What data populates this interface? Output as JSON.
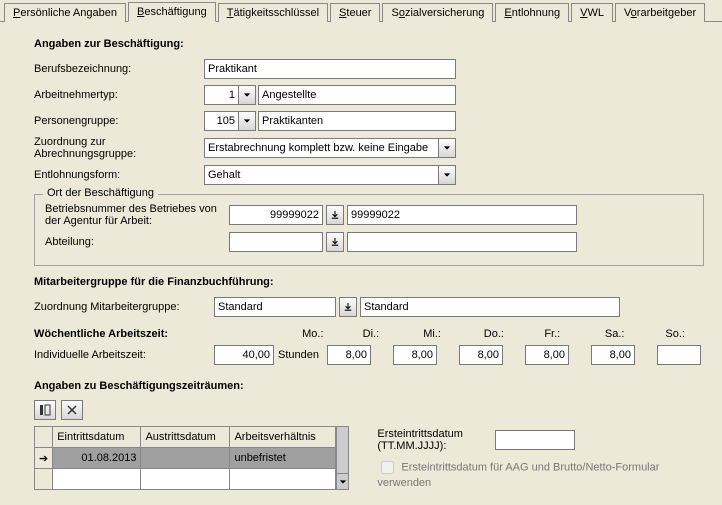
{
  "tabs": {
    "t0": "Persönliche Angaben",
    "t1": "Beschäftigung",
    "t2": "Tätigkeitsschlüssel",
    "t3": "Steuer",
    "t4": "Sozialversicherung",
    "t5": "Entlohnung",
    "t6": "VWL",
    "t7": "Vorarbeitgeber"
  },
  "section_employment": "Angaben zur Beschäftigung:",
  "labels": {
    "jobtitle": "Berufsbezeichnung:",
    "emptype": "Arbeitnehmertyp:",
    "pgroup": "Personengruppe:",
    "assign": "Zuordnung zur Abrechnungsgruppe:",
    "payform": "Entlohnungsform:",
    "workplace_legend": "Ort der Beschäftigung",
    "establishment": "Betriebsnummer des Betriebes von der Agentur für Arbeit:",
    "department": "Abteilung:",
    "fibu_title": "Mitarbeitergruppe für die Finanzbuchführung:",
    "fibu_assign": "Zuordnung Mitarbeitergruppe:",
    "weekly_title": "Wöchentliche Arbeitszeit:",
    "individual": "Individuelle Arbeitszeit:",
    "hours": "Stunden",
    "periods_title": "Angaben zu Beschäftigungszeiträumen:",
    "first_entry": "Ersteintrittsdatum (TT.MM.JJJJ):",
    "use_firstentry": "Ersteintrittsdatum für AAG und Brutto/Netto-Formular verwenden"
  },
  "values": {
    "jobtitle": "Praktikant",
    "emptype_code": "1",
    "emptype_text": "Angestellte",
    "pgroup_code": "105",
    "pgroup_text": "Praktikanten",
    "assign": "Erstabrechnung komplett bzw. keine Eingabe",
    "payform": "Gehalt",
    "establishment_no": "99999022",
    "establishment_text": "99999022",
    "department_code": "",
    "department_text": "",
    "fibu_code": "Standard",
    "fibu_text": "Standard",
    "weekly_hours": "40,00",
    "first_entry_date": ""
  },
  "days": {
    "mo_l": "Mo.:",
    "di_l": "Di.:",
    "mi_l": "Mi.:",
    "do_l": "Do.:",
    "fr_l": "Fr.:",
    "sa_l": "Sa.:",
    "so_l": "So.:",
    "mo": "8,00",
    "di": "8,00",
    "mi": "8,00",
    "do": "8,00",
    "fr": "8,00",
    "sa": "",
    "so": ""
  },
  "grid": {
    "h_entry": "Eintrittsdatum",
    "h_exit": "Austrittsdatum",
    "h_rel": "Arbeitsverhältnis",
    "r0_entry": "01.08.2013",
    "r0_exit": "",
    "r0_rel": "unbefristet"
  }
}
